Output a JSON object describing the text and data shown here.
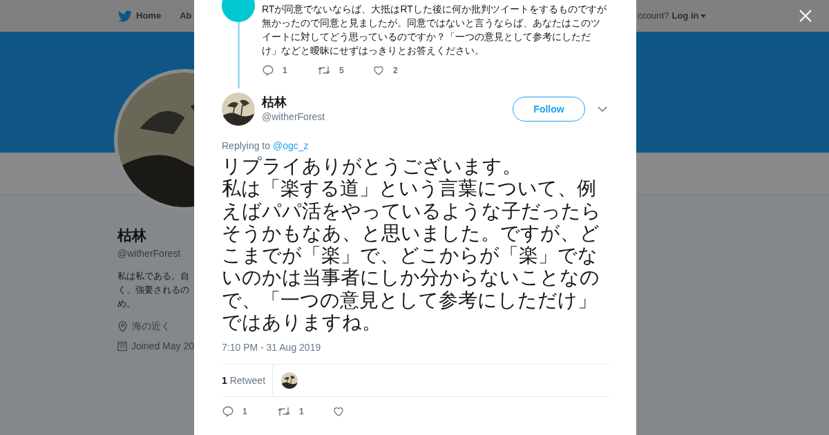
{
  "background_page": {
    "nav": {
      "home": "Home",
      "about": "Ab",
      "account_prompt": "ccount?",
      "login": "Log in"
    },
    "profile": {
      "name": "枯林",
      "handle": "@witherForest",
      "bio": [
        "私は私である。自",
        "く。強要されるの",
        "め。"
      ],
      "location": "海の近く",
      "joined": "Joined May 20"
    }
  },
  "modal": {
    "previous_tweet": {
      "text": "RTが同意でないならば、大抵はRTした後に何か批判ツイートをするものですが無かったので同意と見ましたが。同意ではないと言うならば、あなたはこのツイートに対してどう思っているのですか？「一つの意見として参考にしただけ」などと曖昧にせずはっきりとお答えください。",
      "actions": [
        {
          "kind": "reply",
          "count": "1"
        },
        {
          "kind": "retweet",
          "count": "5"
        },
        {
          "kind": "like",
          "count": "2"
        }
      ]
    },
    "tweet": {
      "name": "枯林",
      "handle": "@witherForest",
      "follow_label": "Follow",
      "replying_prefix": "Replying to",
      "replying_to": "@ogc_z",
      "text": [
        "リプライありがとうございます。",
        "私は「楽する道」という言葉について、例えばパパ活をやっているような子だったらそうかもなあ、と思いました。ですが、どこまでが「楽」で、どこからが「楽」でないのかは当事者にしか分からないことなので、「一つの意見として参考にしただけ」ではありますね。"
      ],
      "timestamp": "7:10 PM - 31 Aug 2019",
      "retweet_count": "1",
      "retweet_label": "Retweet",
      "actions": [
        {
          "kind": "reply",
          "count": "1"
        },
        {
          "kind": "retweet",
          "count": "1"
        },
        {
          "kind": "like"
        }
      ]
    }
  }
}
